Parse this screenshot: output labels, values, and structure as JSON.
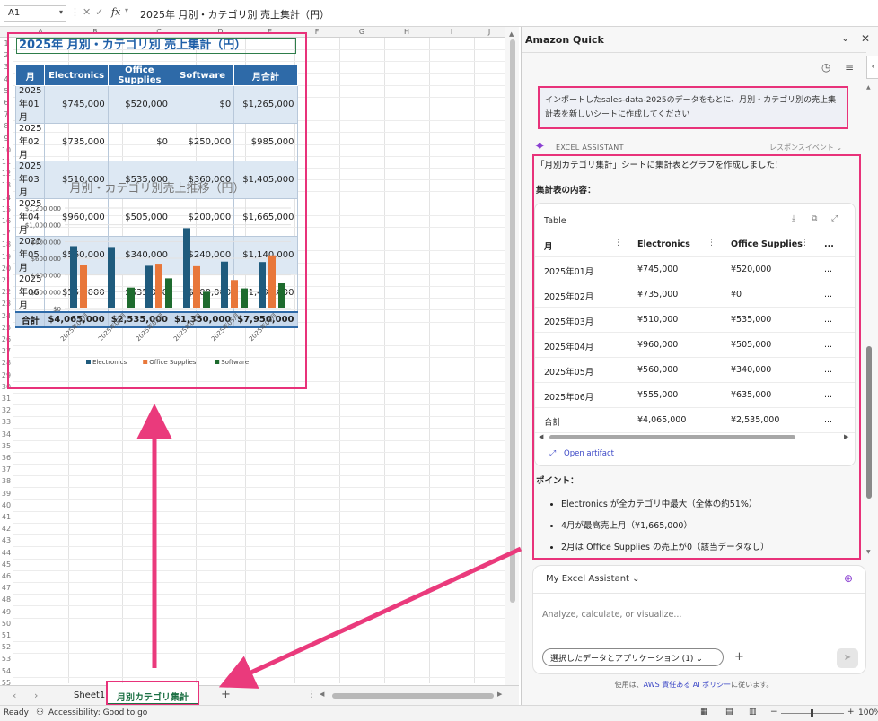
{
  "formula_bar": {
    "cell_ref": "A1",
    "fx_label": "fx",
    "content": "2025年 月別・カテゴリ別 売上集計（円）"
  },
  "columns": [
    "A",
    "B",
    "C",
    "D",
    "E",
    "F",
    "G",
    "H",
    "I",
    "J"
  ],
  "rows": [
    "1",
    "2",
    "3",
    "4",
    "5",
    "6",
    "7",
    "8",
    "9",
    "10",
    "11",
    "12",
    "13",
    "14",
    "15",
    "16",
    "17",
    "18",
    "19",
    "20",
    "21",
    "22",
    "23",
    "24",
    "25",
    "26",
    "27",
    "28",
    "29",
    "30",
    "31",
    "32",
    "33",
    "34",
    "35",
    "36",
    "37",
    "38",
    "39",
    "40",
    "41",
    "42",
    "43",
    "44",
    "45",
    "46",
    "47",
    "48",
    "49",
    "50",
    "51",
    "52",
    "53",
    "54",
    "55"
  ],
  "sheet_title": "2025年 月別・カテゴリ別 売上集計（円）",
  "table": {
    "headers": [
      "月",
      "Electronics",
      "Office Supplies",
      "Software",
      "月合計"
    ],
    "rows": [
      [
        "2025年01月",
        "$745,000",
        "$520,000",
        "$0",
        "$1,265,000"
      ],
      [
        "2025年02月",
        "$735,000",
        "$0",
        "$250,000",
        "$985,000"
      ],
      [
        "2025年03月",
        "$510,000",
        "$535,000",
        "$360,000",
        "$1,405,000"
      ],
      [
        "2025年04月",
        "$960,000",
        "$505,000",
        "$200,000",
        "$1,665,000"
      ],
      [
        "2025年05月",
        "$560,000",
        "$340,000",
        "$240,000",
        "$1,140,000"
      ],
      [
        "2025年06月",
        "$555,000",
        "$635,000",
        "$300,000",
        "$1,490,000"
      ]
    ],
    "total": [
      "合計",
      "$4,065,000",
      "$2,535,000",
      "$1,350,000",
      "$7,950,000"
    ]
  },
  "chart_data": {
    "type": "bar",
    "title": "月別・カテゴリ別売上推移（円）",
    "categories": [
      "2025年01月",
      "2025年02月",
      "2025年03月",
      "2025年04月",
      "2025年05月",
      "2025年06月"
    ],
    "series": [
      {
        "name": "Electronics",
        "values": [
          745000,
          735000,
          510000,
          960000,
          560000,
          555000
        ],
        "color": "#1f5b7d"
      },
      {
        "name": "Office Supplies",
        "values": [
          520000,
          0,
          535000,
          505000,
          340000,
          635000
        ],
        "color": "#e8773a"
      },
      {
        "name": "Software",
        "values": [
          0,
          250000,
          360000,
          200000,
          240000,
          300000
        ],
        "color": "#1e6b2e"
      }
    ],
    "yticks": [
      "$0",
      "$200,000",
      "$400,000",
      "$600,000",
      "$800,000",
      "$1,000,000",
      "$1,200,000"
    ],
    "ylim": [
      0,
      1200000
    ],
    "legend_position": "bottom",
    "grid": true
  },
  "sheet_tabs": {
    "tabs": [
      "Sheet1",
      "月別カテゴリ集計"
    ],
    "active": "月別カテゴリ集計",
    "add": "+"
  },
  "status_bar": {
    "ready": "Ready",
    "accessibility": "Accessibility: Good to go",
    "zoom": "100%"
  },
  "pane": {
    "title": "Amazon Quick",
    "user_message": "インポートしたsales-data-2025のデータをもとに、月別・カテゴリ別の売上集計表を新しいシートに作成してください",
    "assistant_label": "EXCEL ASSISTANT",
    "response_events": "レスポンスイベント",
    "intro": "「月別カテゴリ集計」シートに集計表とグラフを作成しました！",
    "section_heading": "集計表の内容：",
    "artifact_title": "Table",
    "artifact_headers": [
      "月",
      "Electronics",
      "Office Supplies",
      "..."
    ],
    "artifact_rows": [
      [
        "2025年01月",
        "¥745,000",
        "¥520,000",
        "..."
      ],
      [
        "2025年02月",
        "¥735,000",
        "¥0",
        "..."
      ],
      [
        "2025年03月",
        "¥510,000",
        "¥535,000",
        "..."
      ],
      [
        "2025年04月",
        "¥960,000",
        "¥505,000",
        "..."
      ],
      [
        "2025年05月",
        "¥560,000",
        "¥340,000",
        "..."
      ],
      [
        "2025年06月",
        "¥555,000",
        "¥635,000",
        "..."
      ],
      [
        "合計",
        "¥4,065,000",
        "¥2,535,000",
        "..."
      ]
    ],
    "open_artifact": "Open artifact",
    "points_heading": "ポイント：",
    "points": [
      "Electronics が全カテゴリ中最大（全体の約51%）",
      "4月が最高売上月（¥1,665,000）",
      "2月は Office Supplies の売上が0（該当データなし）"
    ],
    "assistant_selector": "My Excel Assistant",
    "input_placeholder": "Analyze, calculate, or visualize...",
    "context_button": "選択したデータとアプリケーション (1)",
    "footer_prefix": "使用は、",
    "footer_link": "AWS 責任ある AI ポリシー",
    "footer_suffix": "に従います。"
  }
}
